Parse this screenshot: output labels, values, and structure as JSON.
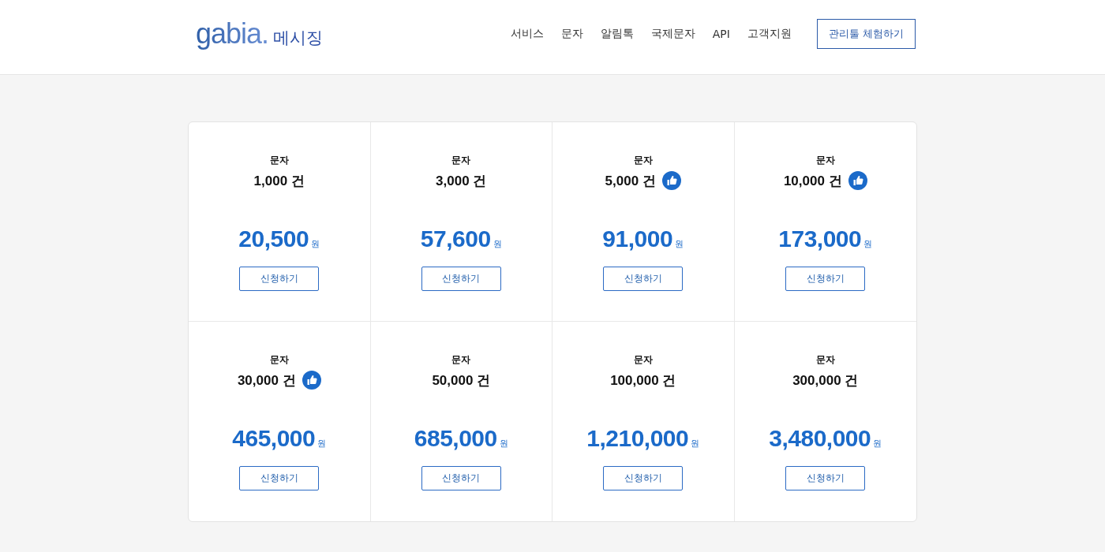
{
  "header": {
    "logo": {
      "wordmark": "gabia.",
      "product": "메시징"
    },
    "nav": [
      "서비스",
      "문자",
      "알림톡",
      "국제문자",
      "API",
      "고객지원"
    ],
    "cta": "관리툴 체험하기"
  },
  "plans": [
    {
      "type": "문자",
      "count": "1,000",
      "count_unit": "건",
      "recommended": false,
      "price": "20,500",
      "currency": "원",
      "button": "신청하기"
    },
    {
      "type": "문자",
      "count": "3,000",
      "count_unit": "건",
      "recommended": false,
      "price": "57,600",
      "currency": "원",
      "button": "신청하기"
    },
    {
      "type": "문자",
      "count": "5,000",
      "count_unit": "건",
      "recommended": true,
      "price": "91,000",
      "currency": "원",
      "button": "신청하기"
    },
    {
      "type": "문자",
      "count": "10,000",
      "count_unit": "건",
      "recommended": true,
      "price": "173,000",
      "currency": "원",
      "button": "신청하기"
    },
    {
      "type": "문자",
      "count": "30,000",
      "count_unit": "건",
      "recommended": true,
      "price": "465,000",
      "currency": "원",
      "button": "신청하기"
    },
    {
      "type": "문자",
      "count": "50,000",
      "count_unit": "건",
      "recommended": false,
      "price": "685,000",
      "currency": "원",
      "button": "신청하기"
    },
    {
      "type": "문자",
      "count": "100,000",
      "count_unit": "건",
      "recommended": false,
      "price": "1,210,000",
      "currency": "원",
      "button": "신청하기"
    },
    {
      "type": "문자",
      "count": "300,000",
      "count_unit": "건",
      "recommended": false,
      "price": "3,480,000",
      "currency": "원",
      "button": "신청하기"
    }
  ]
}
